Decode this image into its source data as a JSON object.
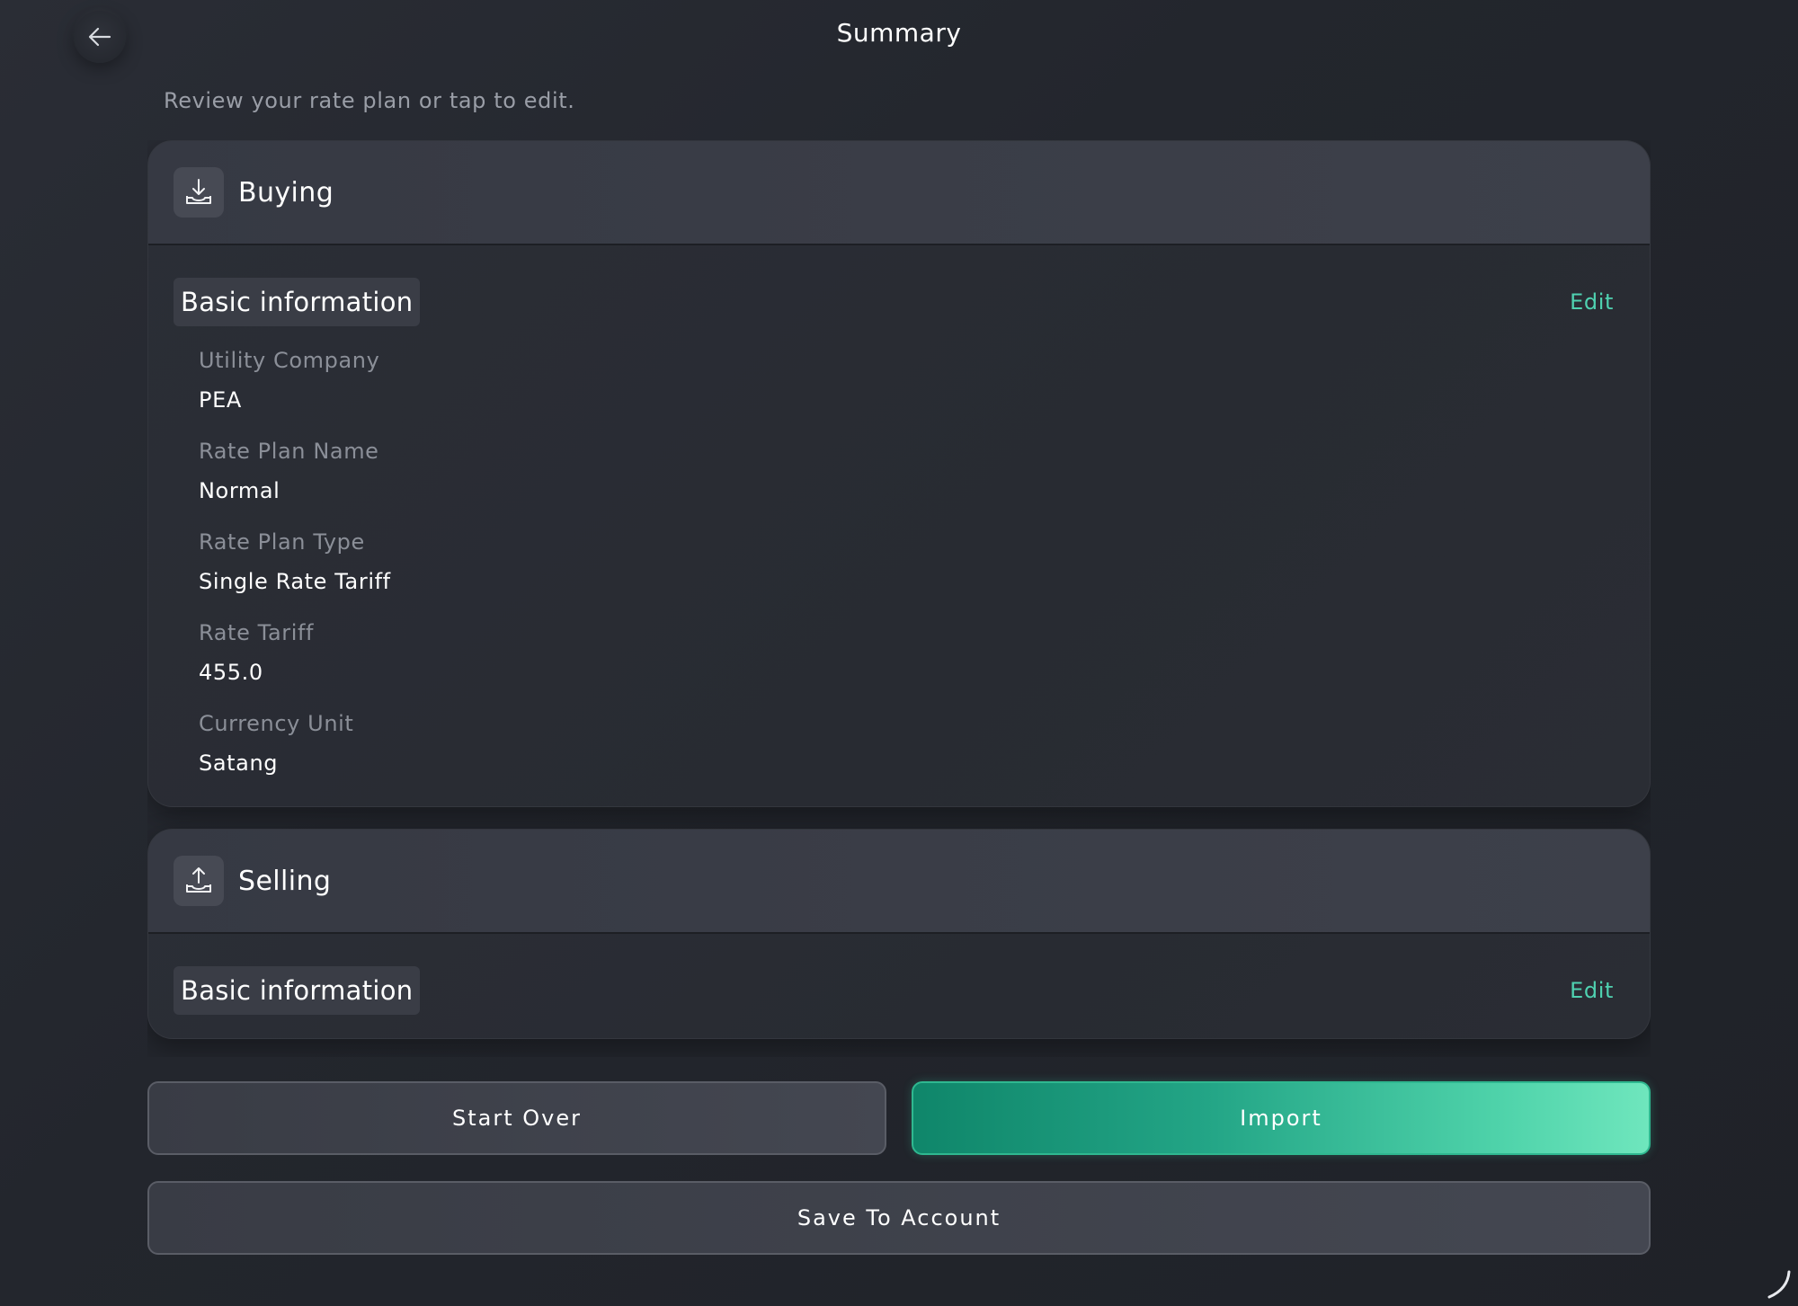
{
  "header": {
    "title": "Summary",
    "subtitle": "Review your rate plan or tap to edit.",
    "back_icon": "arrow-left-icon"
  },
  "buying": {
    "title": "Buying",
    "icon": "download-tray-icon",
    "section_title": "Basic information",
    "edit_label": "Edit",
    "fields": [
      {
        "label": "Utility Company",
        "value": "PEA"
      },
      {
        "label": "Rate Plan Name",
        "value": "Normal"
      },
      {
        "label": "Rate Plan Type",
        "value": "Single Rate Tariff"
      },
      {
        "label": "Rate Tariff",
        "value": "455.0"
      },
      {
        "label": "Currency Unit",
        "value": "Satang"
      }
    ]
  },
  "selling": {
    "title": "Selling",
    "icon": "upload-tray-icon",
    "section_title": "Basic information",
    "edit_label": "Edit"
  },
  "actions": {
    "start_over_label": "Start Over",
    "import_label": "Import",
    "save_label": "Save To Account"
  },
  "colors": {
    "accent": "#4fd1b0",
    "background": "#262930",
    "primary_start": "#0f866a",
    "primary_end": "#6fe6bd"
  }
}
